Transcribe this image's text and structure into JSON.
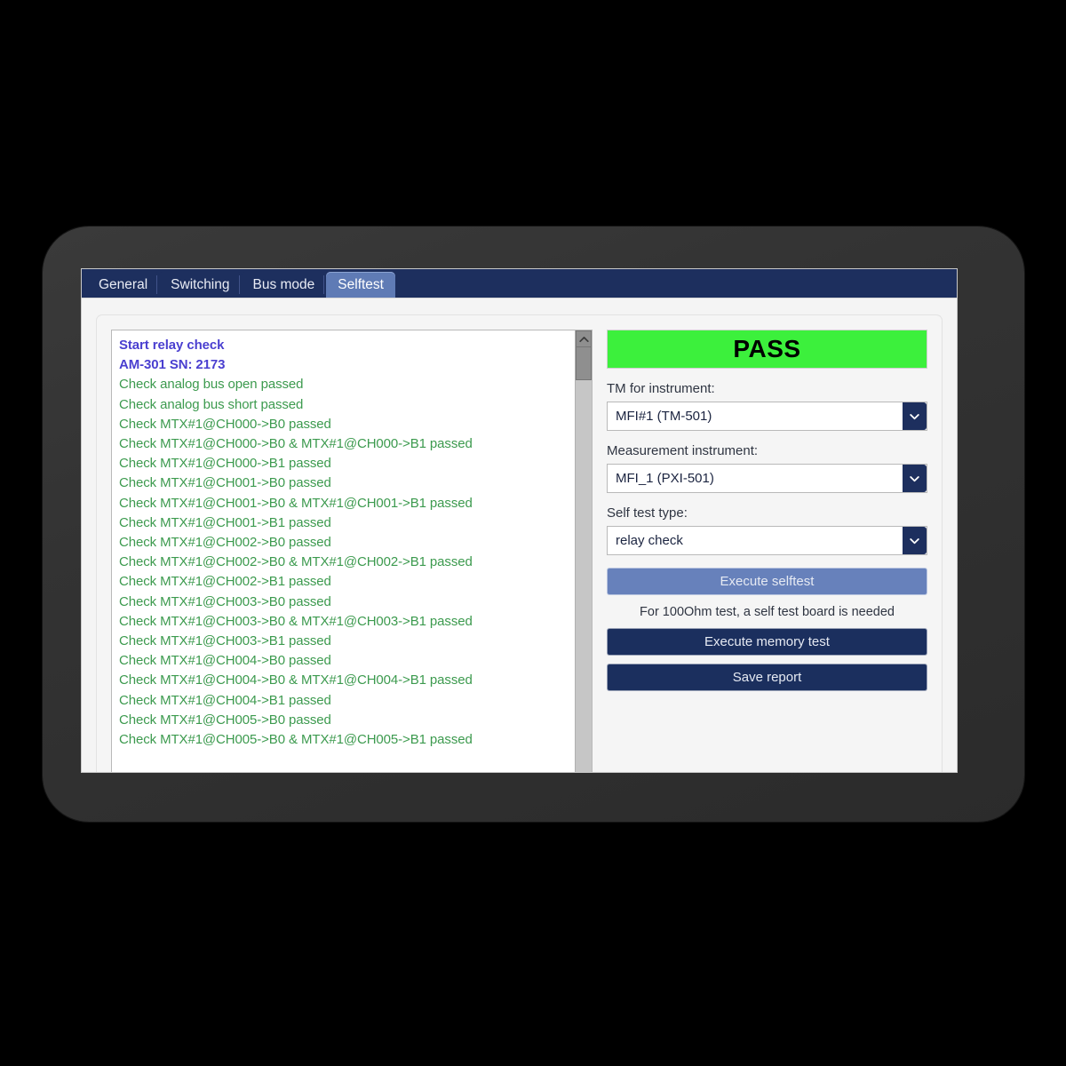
{
  "window": {
    "tabs": [
      {
        "label": "General",
        "active": false
      },
      {
        "label": "Switching",
        "active": false
      },
      {
        "label": "Bus mode",
        "active": false
      },
      {
        "label": "Selftest",
        "active": true
      }
    ]
  },
  "log": {
    "lines": [
      {
        "text": "Start relay check",
        "kind": "hdr"
      },
      {
        "text": "AM-301 SN: 2173",
        "kind": "hdr"
      },
      {
        "text": "Check analog bus open passed",
        "kind": "ok"
      },
      {
        "text": "Check analog bus short passed",
        "kind": "ok"
      },
      {
        "text": "Check MTX#1@CH000->B0 passed",
        "kind": "ok"
      },
      {
        "text": "Check MTX#1@CH000->B0 & MTX#1@CH000->B1 passed",
        "kind": "ok"
      },
      {
        "text": "Check MTX#1@CH000->B1 passed",
        "kind": "ok"
      },
      {
        "text": "Check MTX#1@CH001->B0 passed",
        "kind": "ok"
      },
      {
        "text": "Check MTX#1@CH001->B0 & MTX#1@CH001->B1 passed",
        "kind": "ok"
      },
      {
        "text": "Check MTX#1@CH001->B1 passed",
        "kind": "ok"
      },
      {
        "text": "Check MTX#1@CH002->B0 passed",
        "kind": "ok"
      },
      {
        "text": "Check MTX#1@CH002->B0 & MTX#1@CH002->B1 passed",
        "kind": "ok"
      },
      {
        "text": "Check MTX#1@CH002->B1 passed",
        "kind": "ok"
      },
      {
        "text": "Check MTX#1@CH003->B0 passed",
        "kind": "ok"
      },
      {
        "text": "Check MTX#1@CH003->B0 & MTX#1@CH003->B1 passed",
        "kind": "ok"
      },
      {
        "text": "Check MTX#1@CH003->B1 passed",
        "kind": "ok"
      },
      {
        "text": "Check MTX#1@CH004->B0 passed",
        "kind": "ok"
      },
      {
        "text": "Check MTX#1@CH004->B0 & MTX#1@CH004->B1 passed",
        "kind": "ok"
      },
      {
        "text": "Check MTX#1@CH004->B1 passed",
        "kind": "ok"
      },
      {
        "text": "Check MTX#1@CH005->B0 passed",
        "kind": "ok"
      },
      {
        "text": "Check MTX#1@CH005->B0 & MTX#1@CH005->B1 passed",
        "kind": "ok"
      }
    ],
    "scrollbar": {
      "up_icon": "chevron-up-icon"
    }
  },
  "sidebar": {
    "status": {
      "text": "PASS",
      "color": "#3cf03c"
    },
    "tm_instrument": {
      "label": "TM for instrument:",
      "value": "MFI#1 (TM-501)"
    },
    "measurement_instrument": {
      "label": "Measurement instrument:",
      "value": "MFI_1 (PXI-501)"
    },
    "selftest_type": {
      "label": "Self test type:",
      "value": "relay check"
    },
    "execute_selftest_label": "Execute selftest",
    "hint": "For 100Ohm test, a self test board is needed",
    "execute_memory_test_label": "Execute memory test",
    "save_report_label": "Save report"
  }
}
